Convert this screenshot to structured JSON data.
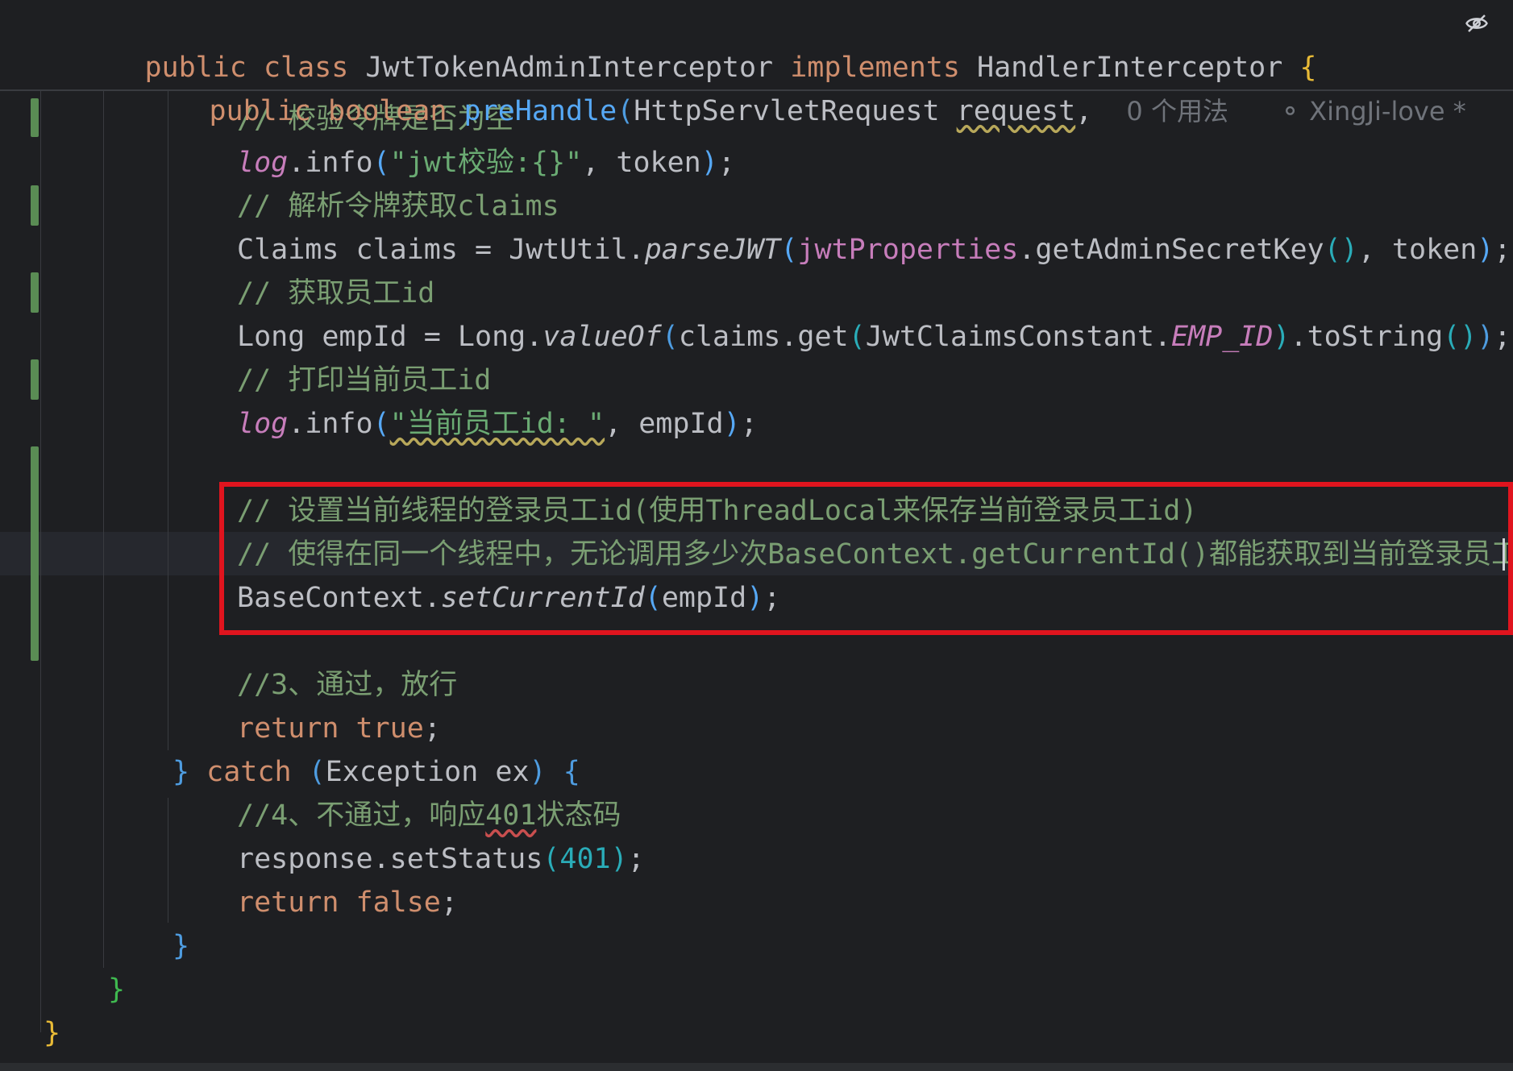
{
  "header": {
    "line1_kw1": "public",
    "line1_kw2": "class",
    "line1_name": "JwtTokenAdminInterceptor",
    "line1_kw3": "implements",
    "line1_iface": "HandlerInterceptor",
    "line1_brace": "{",
    "line2_kw1": "public",
    "line2_kw2": "boolean",
    "line2_method": "preHandle",
    "line2_paren": "(",
    "line2_type": "HttpServletRequest",
    "line2_param": "request",
    "line2_comma": ",",
    "usages_hint": "0 个用法",
    "author_hint": "XingJi-love *"
  },
  "code": {
    "c1": "// 校验令牌是否为空",
    "l2_log": "log",
    "l2_info": ".info",
    "l2_str": "\"jwt校验:{}\"",
    "l2_rest": ", token",
    "c3": "// 解析令牌获取claims",
    "l4_a": "Claims claims = JwtUtil.",
    "l4_parse": "parseJWT",
    "l4_field": "jwtProperties",
    "l4_b": ".getAdminSecretKey",
    "l4_c": ", token",
    "c5": "// 获取员工id",
    "l6_a": "Long empId = Long.",
    "l6_valueof": "valueOf",
    "l6_b": "claims.get",
    "l6_c": "JwtClaimsConstant.",
    "l6_const": "EMP_ID",
    "l6_d": ".toString",
    "c7": "// 打印当前员工id",
    "l8_log": "log",
    "l8_info": ".info",
    "l8_str": "\"当前员工id: \"",
    "l8_rest": ", empId",
    "c10": "// 设置当前线程的登录员工id(使用ThreadLocal来保存当前登录员工id)",
    "c11": "// 使得在同一个线程中，无论调用多少次BaseContext.getCurrentId()都能获取到当前登录员工id",
    "l12_a": "BaseContext.",
    "l12_set": "setCurrentId",
    "l12_b": "empId",
    "c14": "//3、通过，放行",
    "l15_return": "return",
    "l15_true": "true",
    "l16_brace": "}",
    "l16_catch": "catch",
    "l16_ex": "Exception ex",
    "c17_a": "//4、不通过，响应",
    "c17_b": "401",
    "c17_c": "状态码",
    "l18_a": "response.setStatus",
    "l18_num": "401",
    "l19_return": "return",
    "l19_false": "false",
    "l20_brace": "}",
    "l21_brace": "}",
    "l22_brace": "}"
  },
  "icons": {
    "reader_mode": "eye-slash-icon",
    "author": "user-icon"
  },
  "colors": {
    "background": "#1e1f22",
    "keyword": "#cf8e6d",
    "comment": "#7a9e72",
    "string": "#6aab73",
    "method": "#56a8f5",
    "field": "#c77dbb",
    "number": "#2aacb8",
    "highlight_box": "#e0141e",
    "vcs_changed_marker": "#5a8c54"
  }
}
